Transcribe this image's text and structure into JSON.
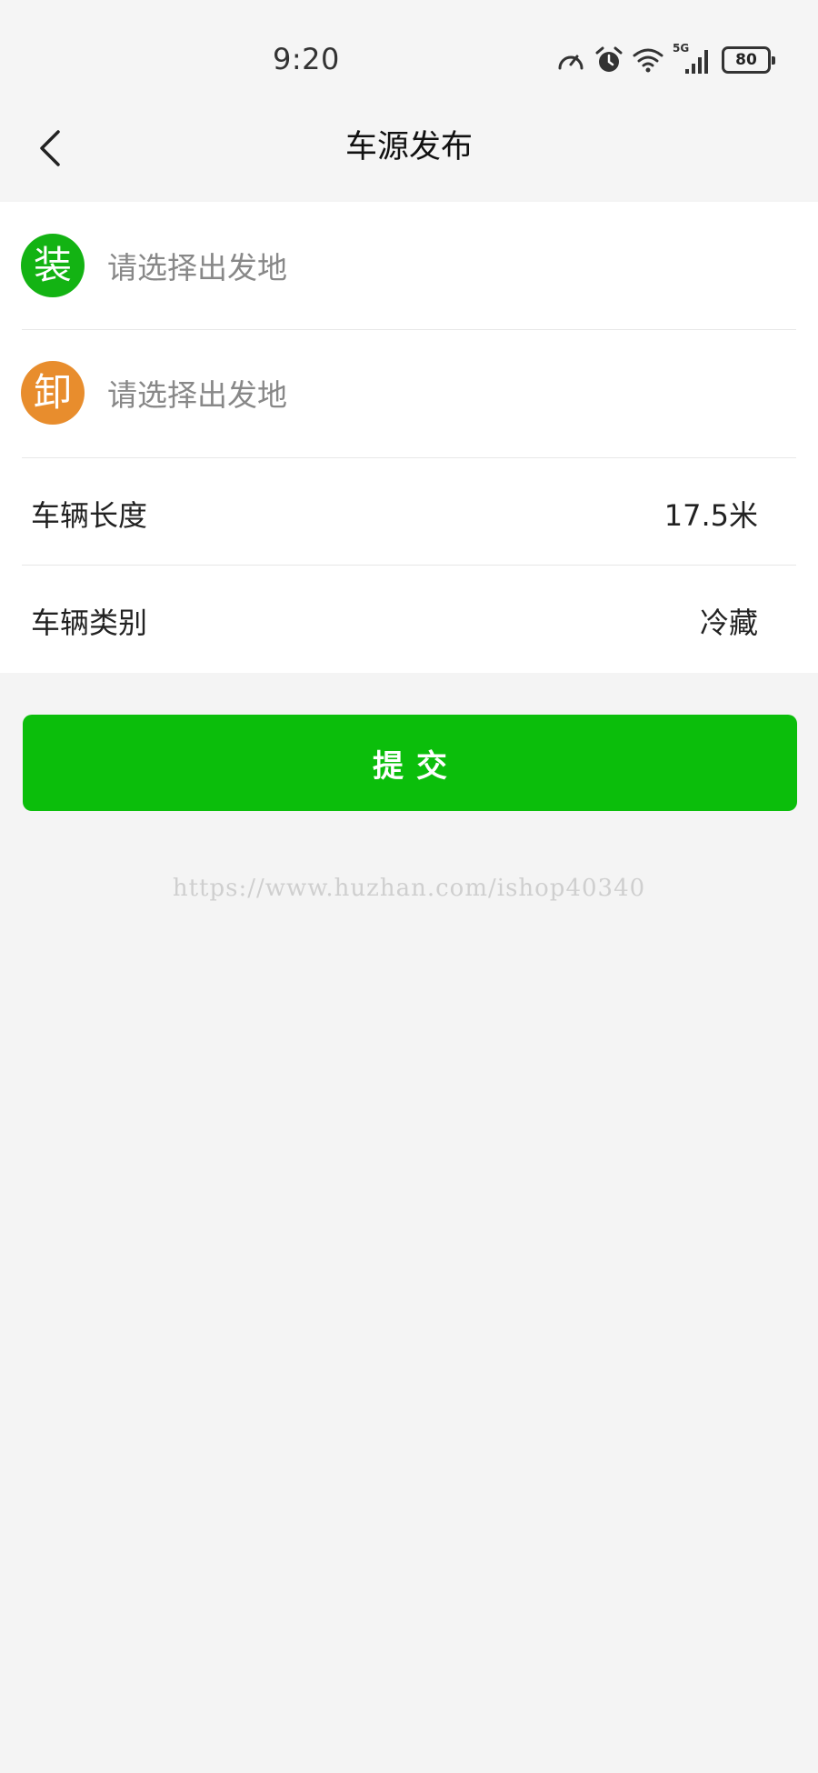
{
  "status_bar": {
    "time": "9:20",
    "network": "5G",
    "battery": "80",
    "icons": [
      "speedometer-icon",
      "alarm-icon",
      "wifi-icon",
      "signal-icon",
      "battery-icon"
    ]
  },
  "nav": {
    "title": "车源发布",
    "back_icon": "chevron-left-icon"
  },
  "form": {
    "loading": {
      "badge": "装",
      "placeholder": "请选择出发地",
      "badge_color": "#13b313"
    },
    "unloading": {
      "badge": "卸",
      "placeholder": "请选择出发地",
      "badge_color": "#e88d2d"
    },
    "vehicle_length": {
      "label": "车辆长度",
      "value": "17.5米"
    },
    "vehicle_type": {
      "label": "车辆类别",
      "value": "冷藏"
    }
  },
  "submit": {
    "label": "提交",
    "color": "#0bbe0b"
  },
  "watermark": "https://www.huzhan.com/ishop40340"
}
